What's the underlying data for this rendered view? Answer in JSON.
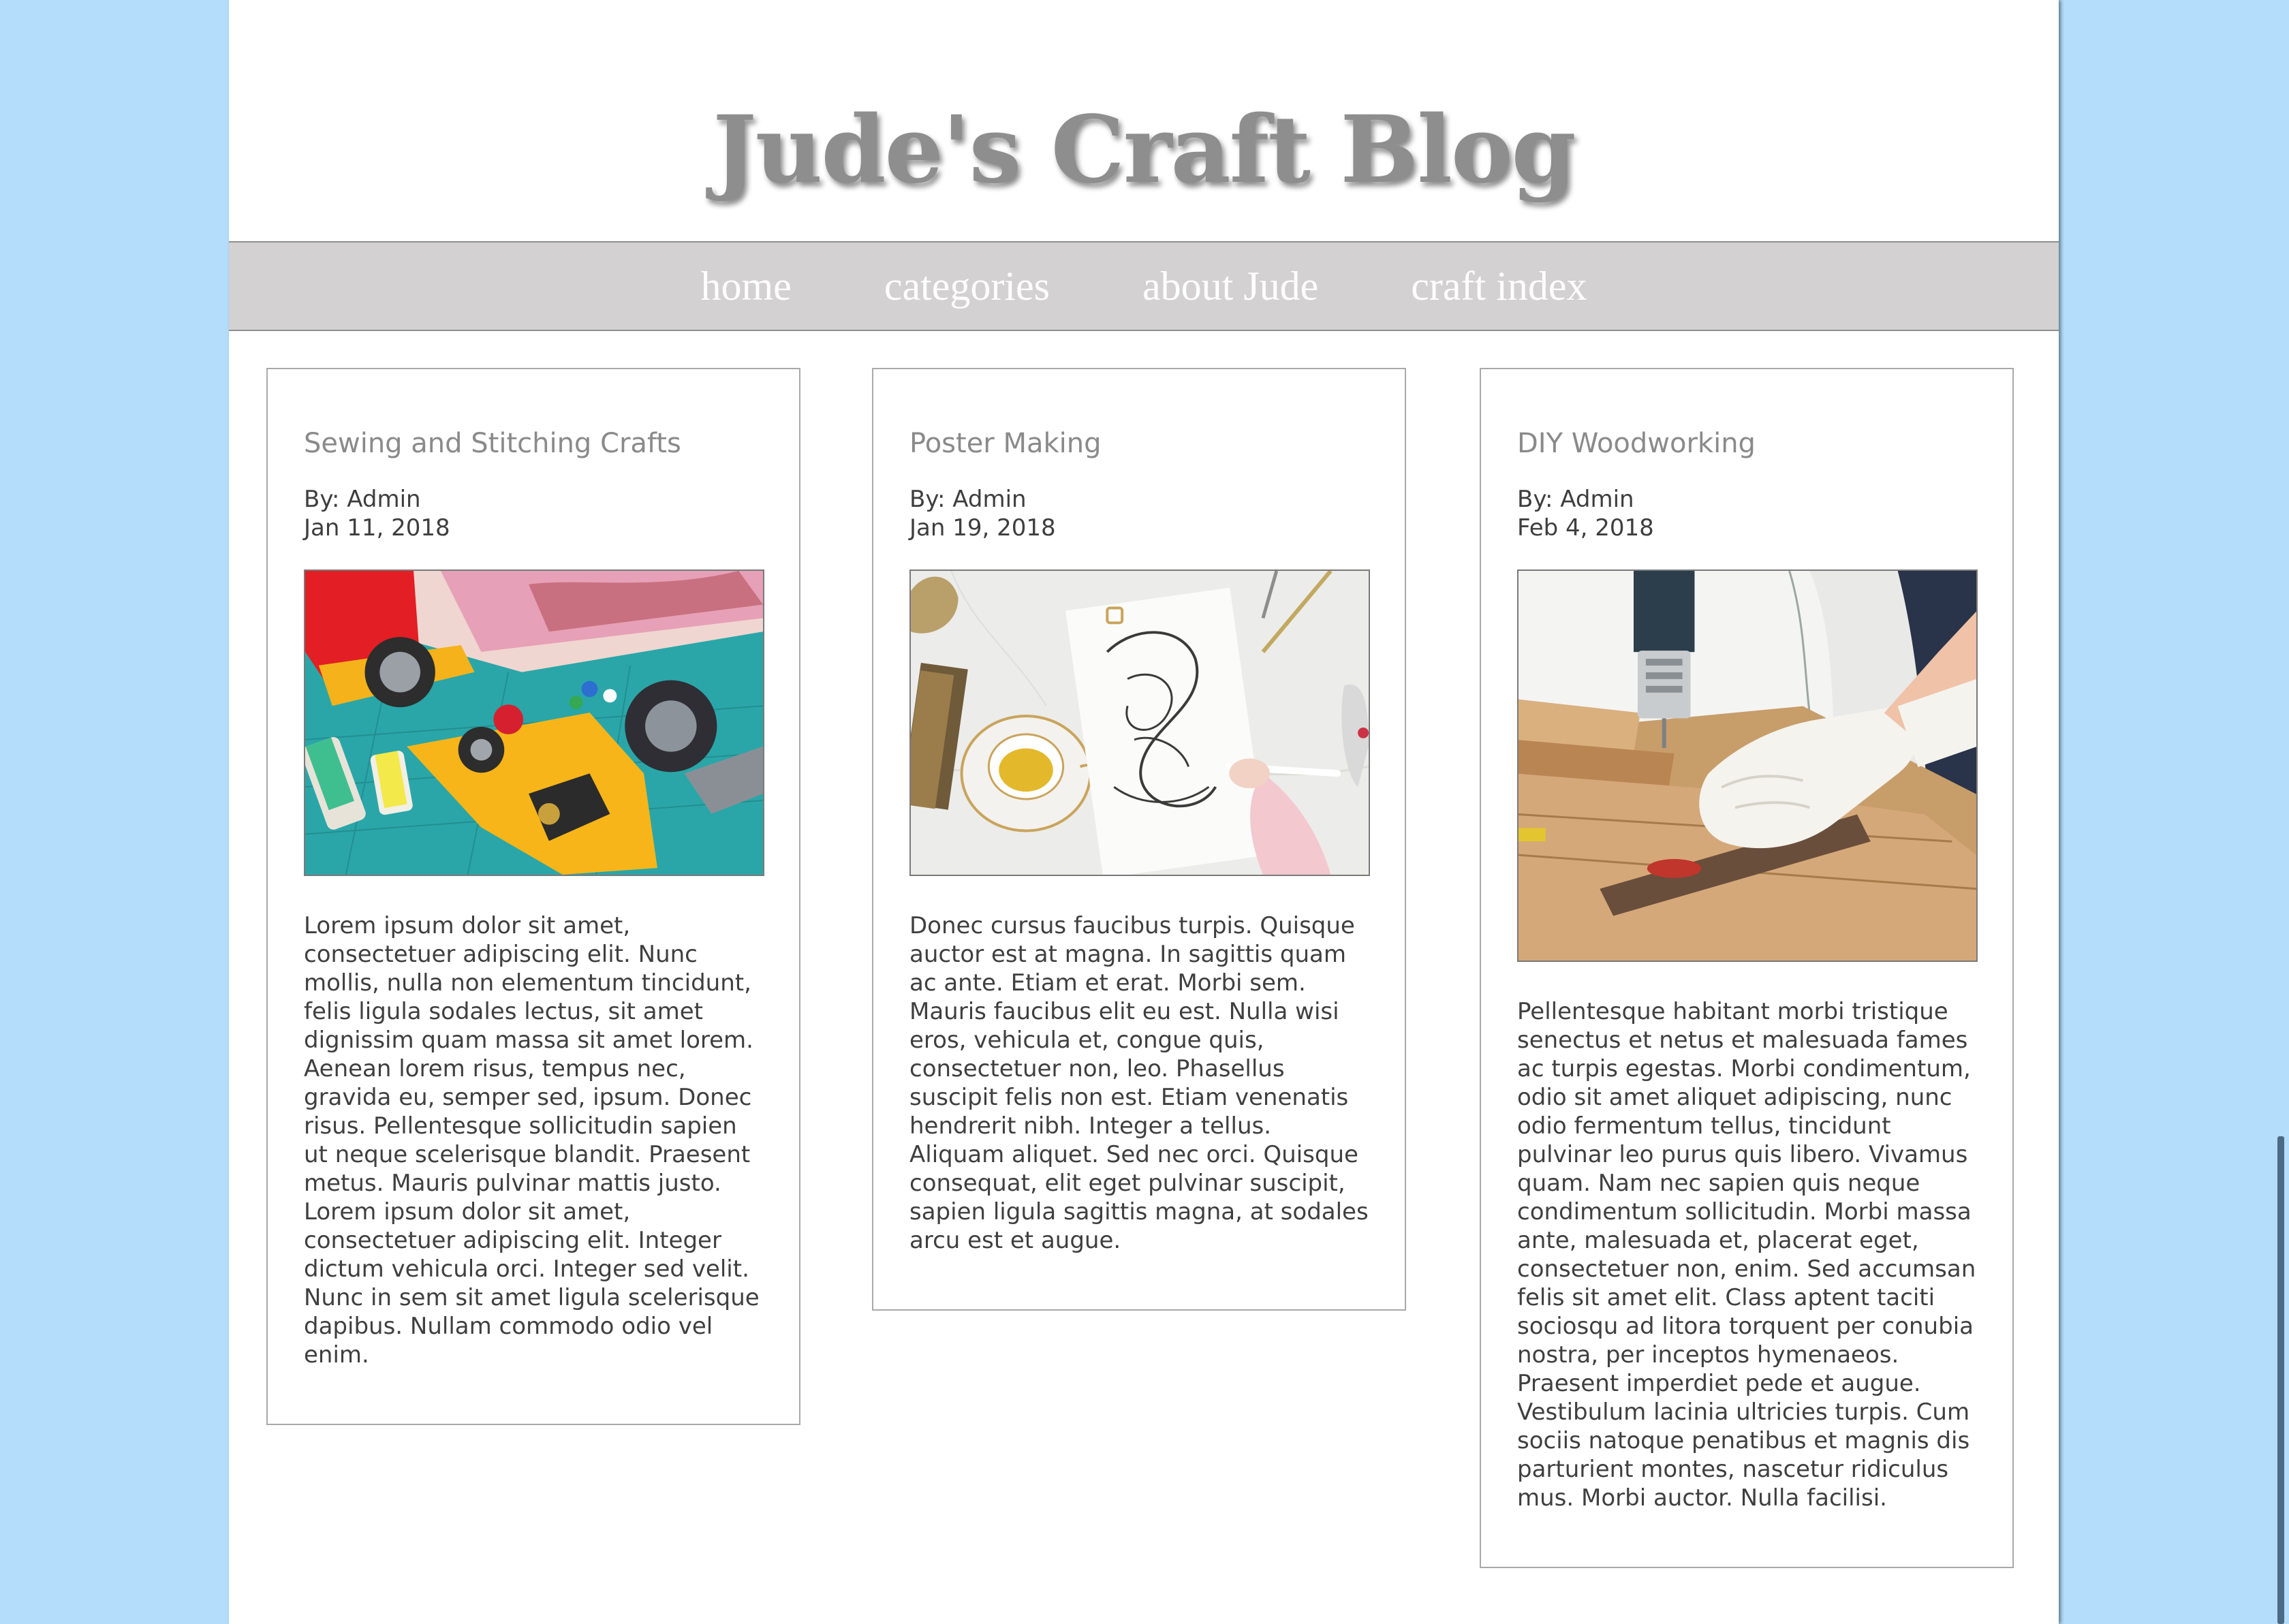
{
  "site": {
    "title": "Jude's Craft Blog"
  },
  "nav": {
    "items": [
      {
        "label": "home"
      },
      {
        "label": "categories"
      },
      {
        "label": "about Jude"
      },
      {
        "label": "craft index"
      }
    ]
  },
  "posts": [
    {
      "title": "Sewing and Stitching Crafts",
      "author": "By: Admin",
      "date": "Jan 11, 2018",
      "image": "sewing-tools-photo",
      "body": "Lorem ipsum dolor sit amet, consectetuer adipiscing elit. Nunc mollis, nulla non elementum tincidunt, felis ligula sodales lectus, sit amet dignissim quam massa sit amet lorem. Aenean lorem risus, tempus nec, gravida eu, semper sed, ipsum. Donec risus. Pellentesque sollicitudin sapien ut neque scelerisque blandit. Praesent metus. Mauris pulvinar mattis justo. Lorem ipsum dolor sit amet, consectetuer adipiscing elit. Integer dictum vehicula orci. Integer sed velit. Nunc in sem sit amet ligula scelerisque dapibus. Nullam commodo odio vel enim."
    },
    {
      "title": "Poster Making",
      "author": "By: Admin",
      "date": "Jan 19, 2018",
      "image": "poster-lettering-photo",
      "body": "Donec cursus faucibus turpis. Quisque auctor est at magna. In sagittis quam ac ante. Etiam et erat. Morbi sem. Mauris faucibus elit eu est. Nulla wisi eros, vehicula et, congue quis, consectetuer non, leo. Phasellus suscipit felis non est. Etiam venenatis hendrerit nibh. Integer a tellus. Aliquam aliquet. Sed nec orci. Quisque consequat, elit eget pulvinar suscipit, sapien ligula sagittis magna, at sodales arcu est et augue."
    },
    {
      "title": "DIY Woodworking",
      "author": "By: Admin",
      "date": "Feb 4, 2018",
      "image": "woodworking-drill-photo",
      "body": "Pellentesque habitant morbi tristique senectus et netus et malesuada fames ac turpis egestas. Morbi condimentum, odio sit amet aliquet adipiscing, nunc odio fermentum tellus, tincidunt pulvinar leo purus quis libero. Vivamus quam. Nam nec sapien quis neque condimentum sollicitudin. Morbi massa ante, malesuada et, placerat eget, consectetuer non, enim. Sed accumsan felis sit amet elit. Class aptent taciti sociosqu ad litora torquent per conubia nostra, per inceptos hymenaeos. Praesent imperdiet pede et augue. Vestibulum lacinia ultricies turpis. Cum sociis natoque penatibus et magnis dis parturient montes, nascetur ridiculus mus. Morbi auctor. Nulla facilisi."
    }
  ],
  "colors": {
    "background": "#b3ddfb",
    "nav_bar": "#d3d1d1",
    "title_gray": "#8e8e8e"
  }
}
